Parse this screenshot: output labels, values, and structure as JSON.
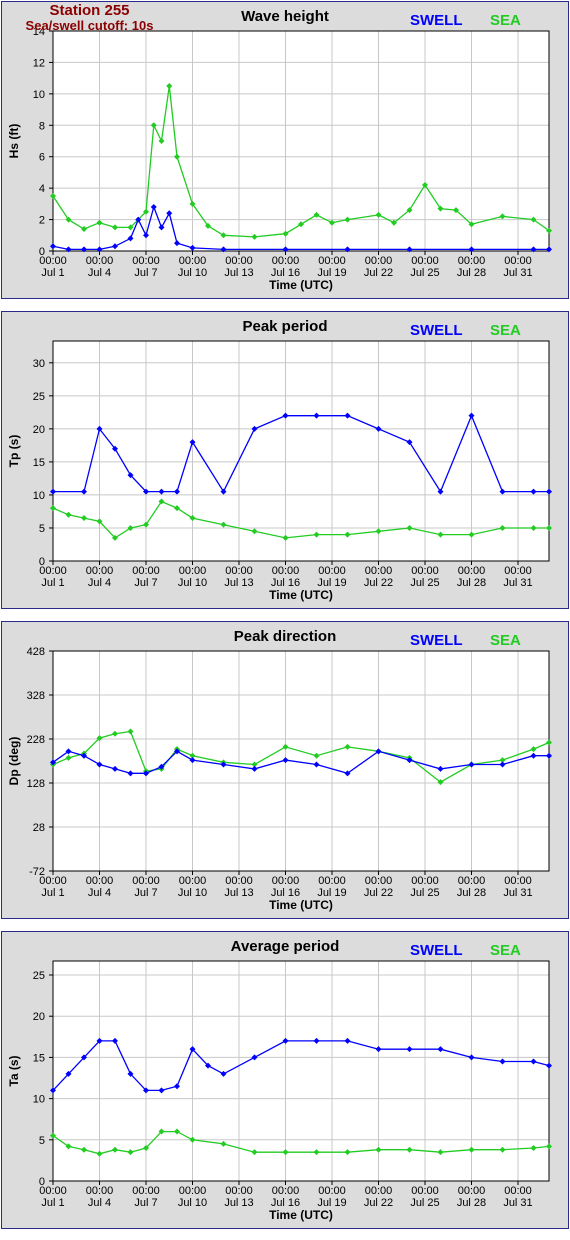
{
  "header": {
    "station": "Station 255",
    "cutoff": "Sea/swell cutoff: 10s"
  },
  "legend": {
    "swell": "SWELL",
    "sea": "SEA",
    "swell_color": "#0000ff",
    "sea_color": "#22cc22"
  },
  "x_axis": {
    "title": "Time (UTC)",
    "ticks": [
      {
        "time": "00:00",
        "date": "Jul 1"
      },
      {
        "time": "00:00",
        "date": "Jul 4"
      },
      {
        "time": "00:00",
        "date": "Jul 7"
      },
      {
        "time": "00:00",
        "date": "Jul 10"
      },
      {
        "time": "00:00",
        "date": "Jul 13"
      },
      {
        "time": "00:00",
        "date": "Jul 16"
      },
      {
        "time": "00:00",
        "date": "Jul 19"
      },
      {
        "time": "00:00",
        "date": "Jul 22"
      },
      {
        "time": "00:00",
        "date": "Jul 25"
      },
      {
        "time": "00:00",
        "date": "Jul 28"
      },
      {
        "time": "00:00",
        "date": "Jul 31"
      }
    ]
  },
  "chart_data": [
    {
      "type": "line",
      "title": "Wave height",
      "xlabel": "Time (UTC)",
      "ylabel": "Hs (ft)",
      "ylim": [
        0,
        14
      ],
      "yticks": [
        0,
        2,
        4,
        6,
        8,
        10,
        12,
        14
      ],
      "xlim": [
        "Jul 1",
        "Aug 2"
      ],
      "grid": true,
      "legend": "top-right",
      "series": [
        {
          "name": "SWELL",
          "x": [
            "Jul 1",
            "Jul 2",
            "Jul 3",
            "Jul 4",
            "Jul 5",
            "Jul 6",
            "Jul 6 12:00",
            "Jul 7",
            "Jul 7 12:00",
            "Jul 8",
            "Jul 8 12:00",
            "Jul 9",
            "Jul 10",
            "Jul 12",
            "Jul 16",
            "Jul 20",
            "Jul 24",
            "Jul 28",
            "Aug 1",
            "Aug 2"
          ],
          "values": [
            0.3,
            0.1,
            0.1,
            0.1,
            0.3,
            0.8,
            2.0,
            1.0,
            2.8,
            1.5,
            2.4,
            0.5,
            0.2,
            0.1,
            0.1,
            0.1,
            0.1,
            0.1,
            0.1,
            0.1
          ]
        },
        {
          "name": "SEA",
          "x": [
            "Jul 1",
            "Jul 2",
            "Jul 3",
            "Jul 4",
            "Jul 5",
            "Jul 6",
            "Jul 7",
            "Jul 7 12:00",
            "Jul 8",
            "Jul 8 12:00",
            "Jul 9",
            "Jul 10",
            "Jul 11",
            "Jul 12",
            "Jul 14",
            "Jul 16",
            "Jul 17",
            "Jul 18",
            "Jul 19",
            "Jul 20",
            "Jul 22",
            "Jul 23",
            "Jul 24",
            "Jul 25",
            "Jul 26",
            "Jul 27",
            "Jul 28",
            "Jul 30",
            "Aug 1",
            "Aug 2"
          ],
          "values": [
            3.5,
            2.0,
            1.4,
            1.8,
            1.5,
            1.5,
            2.5,
            8.0,
            7.0,
            10.5,
            6.0,
            3.0,
            1.6,
            1.0,
            0.9,
            1.1,
            1.7,
            2.3,
            1.8,
            2.0,
            2.3,
            1.8,
            2.6,
            4.2,
            2.7,
            2.6,
            1.7,
            2.2,
            2.0,
            1.3
          ]
        }
      ]
    },
    {
      "type": "line",
      "title": "Peak period",
      "xlabel": "Time (UTC)",
      "ylabel": "Tp (s)",
      "ylim": [
        0,
        33.3
      ],
      "yticks": [
        0,
        5,
        10,
        15,
        20,
        25,
        30
      ],
      "xlim": [
        "Jul 1",
        "Aug 2"
      ],
      "grid": true,
      "legend": "top-right",
      "series": [
        {
          "name": "SWELL",
          "x": [
            "Jul 1",
            "Jul 3",
            "Jul 4",
            "Jul 5",
            "Jul 6",
            "Jul 7",
            "Jul 8",
            "Jul 9",
            "Jul 10",
            "Jul 12",
            "Jul 14",
            "Jul 16",
            "Jul 18",
            "Jul 20",
            "Jul 22",
            "Jul 24",
            "Jul 26",
            "Jul 28",
            "Jul 30",
            "Aug 1",
            "Aug 2"
          ],
          "values": [
            10.5,
            10.5,
            20,
            17,
            13,
            10.5,
            10.5,
            10.5,
            18,
            10.5,
            20,
            22,
            22,
            22,
            20,
            18,
            10.5,
            22,
            10.5,
            10.5,
            10.5
          ]
        },
        {
          "name": "SEA",
          "x": [
            "Jul 1",
            "Jul 2",
            "Jul 3",
            "Jul 4",
            "Jul 5",
            "Jul 6",
            "Jul 7",
            "Jul 8",
            "Jul 9",
            "Jul 10",
            "Jul 12",
            "Jul 14",
            "Jul 16",
            "Jul 18",
            "Jul 20",
            "Jul 22",
            "Jul 24",
            "Jul 26",
            "Jul 28",
            "Jul 30",
            "Aug 1",
            "Aug 2"
          ],
          "values": [
            8,
            7,
            6.5,
            6,
            3.5,
            5,
            5.5,
            9,
            8,
            6.5,
            5.5,
            4.5,
            3.5,
            4,
            4,
            4.5,
            5,
            4,
            4,
            5,
            5,
            5
          ]
        }
      ]
    },
    {
      "type": "line",
      "title": "Peak direction",
      "xlabel": "Time (UTC)",
      "ylabel": "Dp (deg)",
      "ylim": [
        -72,
        428
      ],
      "yticks": [
        -72,
        28,
        128,
        228,
        328,
        428
      ],
      "xlim": [
        "Jul 1",
        "Aug 2"
      ],
      "grid": true,
      "legend": "top-right",
      "series": [
        {
          "name": "SWELL",
          "x": [
            "Jul 1",
            "Jul 2",
            "Jul 3",
            "Jul 4",
            "Jul 5",
            "Jul 6",
            "Jul 7",
            "Jul 8",
            "Jul 9",
            "Jul 10",
            "Jul 12",
            "Jul 14",
            "Jul 16",
            "Jul 18",
            "Jul 20",
            "Jul 22",
            "Jul 24",
            "Jul 26",
            "Jul 28",
            "Jul 30",
            "Aug 1",
            "Aug 2"
          ],
          "values": [
            175,
            200,
            190,
            170,
            160,
            150,
            150,
            165,
            200,
            180,
            170,
            160,
            180,
            170,
            150,
            200,
            180,
            160,
            170,
            170,
            190,
            190
          ]
        },
        {
          "name": "SEA",
          "x": [
            "Jul 1",
            "Jul 2",
            "Jul 3",
            "Jul 4",
            "Jul 5",
            "Jul 6",
            "Jul 7",
            "Jul 8",
            "Jul 9",
            "Jul 10",
            "Jul 12",
            "Jul 14",
            "Jul 16",
            "Jul 18",
            "Jul 20",
            "Jul 22",
            "Jul 24",
            "Jul 26",
            "Jul 28",
            "Jul 30",
            "Aug 1",
            "Aug 2"
          ],
          "values": [
            170,
            185,
            195,
            230,
            240,
            245,
            155,
            160,
            205,
            190,
            175,
            170,
            210,
            190,
            210,
            200,
            185,
            130,
            170,
            180,
            205,
            220
          ]
        }
      ]
    },
    {
      "type": "line",
      "title": "Average period",
      "xlabel": "Time (UTC)",
      "ylabel": "Ta (s)",
      "ylim": [
        0,
        26.7
      ],
      "yticks": [
        0,
        5,
        10,
        15,
        20,
        25
      ],
      "xlim": [
        "Jul 1",
        "Aug 2"
      ],
      "grid": true,
      "legend": "top-right",
      "series": [
        {
          "name": "SWELL",
          "x": [
            "Jul 1",
            "Jul 2",
            "Jul 3",
            "Jul 4",
            "Jul 5",
            "Jul 6",
            "Jul 7",
            "Jul 8",
            "Jul 9",
            "Jul 10",
            "Jul 11",
            "Jul 12",
            "Jul 14",
            "Jul 16",
            "Jul 18",
            "Jul 20",
            "Jul 22",
            "Jul 24",
            "Jul 26",
            "Jul 28",
            "Jul 30",
            "Aug 1",
            "Aug 2"
          ],
          "values": [
            11,
            13,
            15,
            17,
            17,
            13,
            11,
            11,
            11.5,
            16,
            14,
            13,
            15,
            17,
            17,
            17,
            16,
            16,
            16,
            15,
            14.5,
            14.5,
            14
          ]
        },
        {
          "name": "SEA",
          "x": [
            "Jul 1",
            "Jul 2",
            "Jul 3",
            "Jul 4",
            "Jul 5",
            "Jul 6",
            "Jul 7",
            "Jul 8",
            "Jul 9",
            "Jul 10",
            "Jul 12",
            "Jul 14",
            "Jul 16",
            "Jul 18",
            "Jul 20",
            "Jul 22",
            "Jul 24",
            "Jul 26",
            "Jul 28",
            "Jul 30",
            "Aug 1",
            "Aug 2"
          ],
          "values": [
            5.5,
            4.2,
            3.8,
            3.3,
            3.8,
            3.5,
            4.0,
            6.0,
            6.0,
            5.0,
            4.5,
            3.5,
            3.5,
            3.5,
            3.5,
            3.8,
            3.8,
            3.5,
            3.8,
            3.8,
            4.0,
            4.2
          ]
        }
      ]
    }
  ]
}
